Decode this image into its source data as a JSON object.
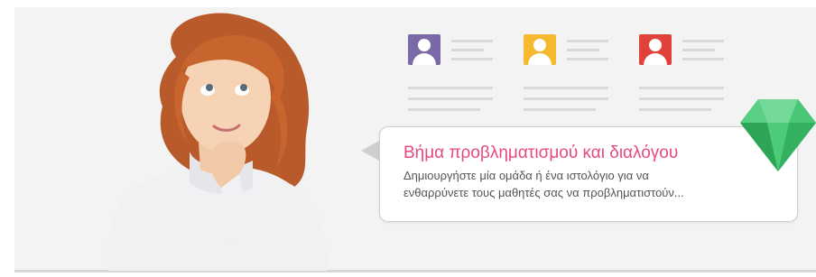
{
  "banner": {
    "title": "Βήμα προβληματισμού και διαλόγου",
    "description_line1": "Δημιουργήστε μία ομάδα ή ένα ιστολόγιο για να",
    "description_line2": "ενθαρρύνετε τους μαθητές σας να προβληματιστούν..."
  },
  "cards": [
    {
      "icon": "user-icon",
      "color": "#7b68a6"
    },
    {
      "icon": "user-icon",
      "color": "#f5b82e"
    },
    {
      "icon": "user-icon",
      "color": "#e0423a"
    }
  ],
  "colors": {
    "accent": "#e8497e",
    "gem": "#3fbf6a",
    "background": "#f3f3f3"
  }
}
